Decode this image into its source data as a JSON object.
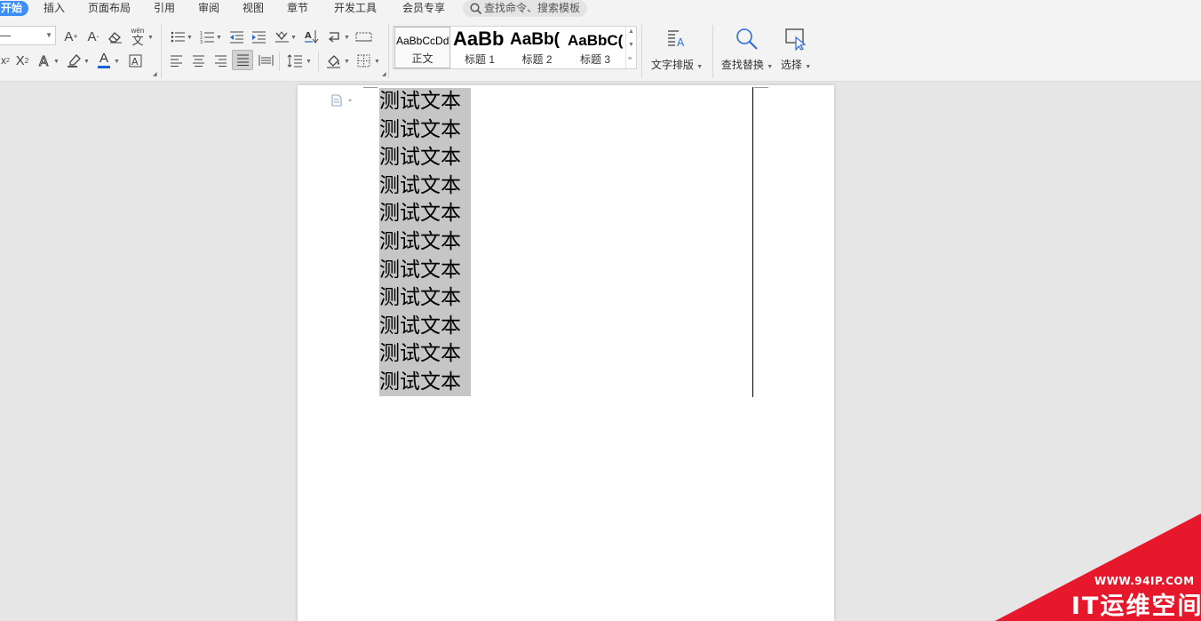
{
  "menu": {
    "tabs": [
      "开始",
      "插入",
      "页面布局",
      "引用",
      "审阅",
      "视图",
      "章节",
      "开发工具",
      "会员专享"
    ],
    "search_placeholder": "查找命令、搜索模板"
  },
  "ribbon": {
    "styles": [
      {
        "preview": "AaBbCcDd",
        "label": "正文"
      },
      {
        "preview": "AaBb",
        "label": "标题 1"
      },
      {
        "preview": "AaBb(",
        "label": "标题 2"
      },
      {
        "preview": "AaBbC(",
        "label": "标题 3"
      }
    ],
    "text_layout_label": "文字排版",
    "find_replace_label": "查找替换",
    "select_label": "选择",
    "pinyin_label": "wén"
  },
  "document": {
    "lines": [
      "测试文本",
      "测试文本",
      "测试文本",
      "测试文本",
      "测试文本",
      "测试文本",
      "测试文本",
      "测试文本",
      "测试文本",
      "测试文本",
      "测试文本"
    ]
  },
  "watermark": {
    "url": "WWW.94IP.COM",
    "name": "IT运维空间",
    "color": "#e8182c"
  },
  "colors": {
    "accent": "#3e8ef7",
    "font_color_underline": "#1f5fcf",
    "selection": "#c6c6c6"
  }
}
